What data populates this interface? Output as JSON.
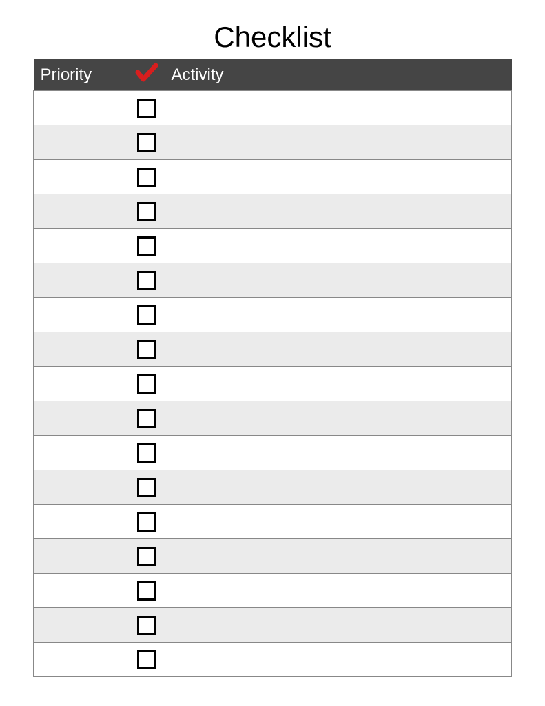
{
  "title": "Checklist",
  "headers": {
    "priority": "Priority",
    "activity": "Activity"
  },
  "rows": [
    {
      "priority": "",
      "activity": "",
      "checked": false
    },
    {
      "priority": "",
      "activity": "",
      "checked": false
    },
    {
      "priority": "",
      "activity": "",
      "checked": false
    },
    {
      "priority": "",
      "activity": "",
      "checked": false
    },
    {
      "priority": "",
      "activity": "",
      "checked": false
    },
    {
      "priority": "",
      "activity": "",
      "checked": false
    },
    {
      "priority": "",
      "activity": "",
      "checked": false
    },
    {
      "priority": "",
      "activity": "",
      "checked": false
    },
    {
      "priority": "",
      "activity": "",
      "checked": false
    },
    {
      "priority": "",
      "activity": "",
      "checked": false
    },
    {
      "priority": "",
      "activity": "",
      "checked": false
    },
    {
      "priority": "",
      "activity": "",
      "checked": false
    },
    {
      "priority": "",
      "activity": "",
      "checked": false
    },
    {
      "priority": "",
      "activity": "",
      "checked": false
    },
    {
      "priority": "",
      "activity": "",
      "checked": false
    },
    {
      "priority": "",
      "activity": "",
      "checked": false
    },
    {
      "priority": "",
      "activity": "",
      "checked": false
    }
  ]
}
